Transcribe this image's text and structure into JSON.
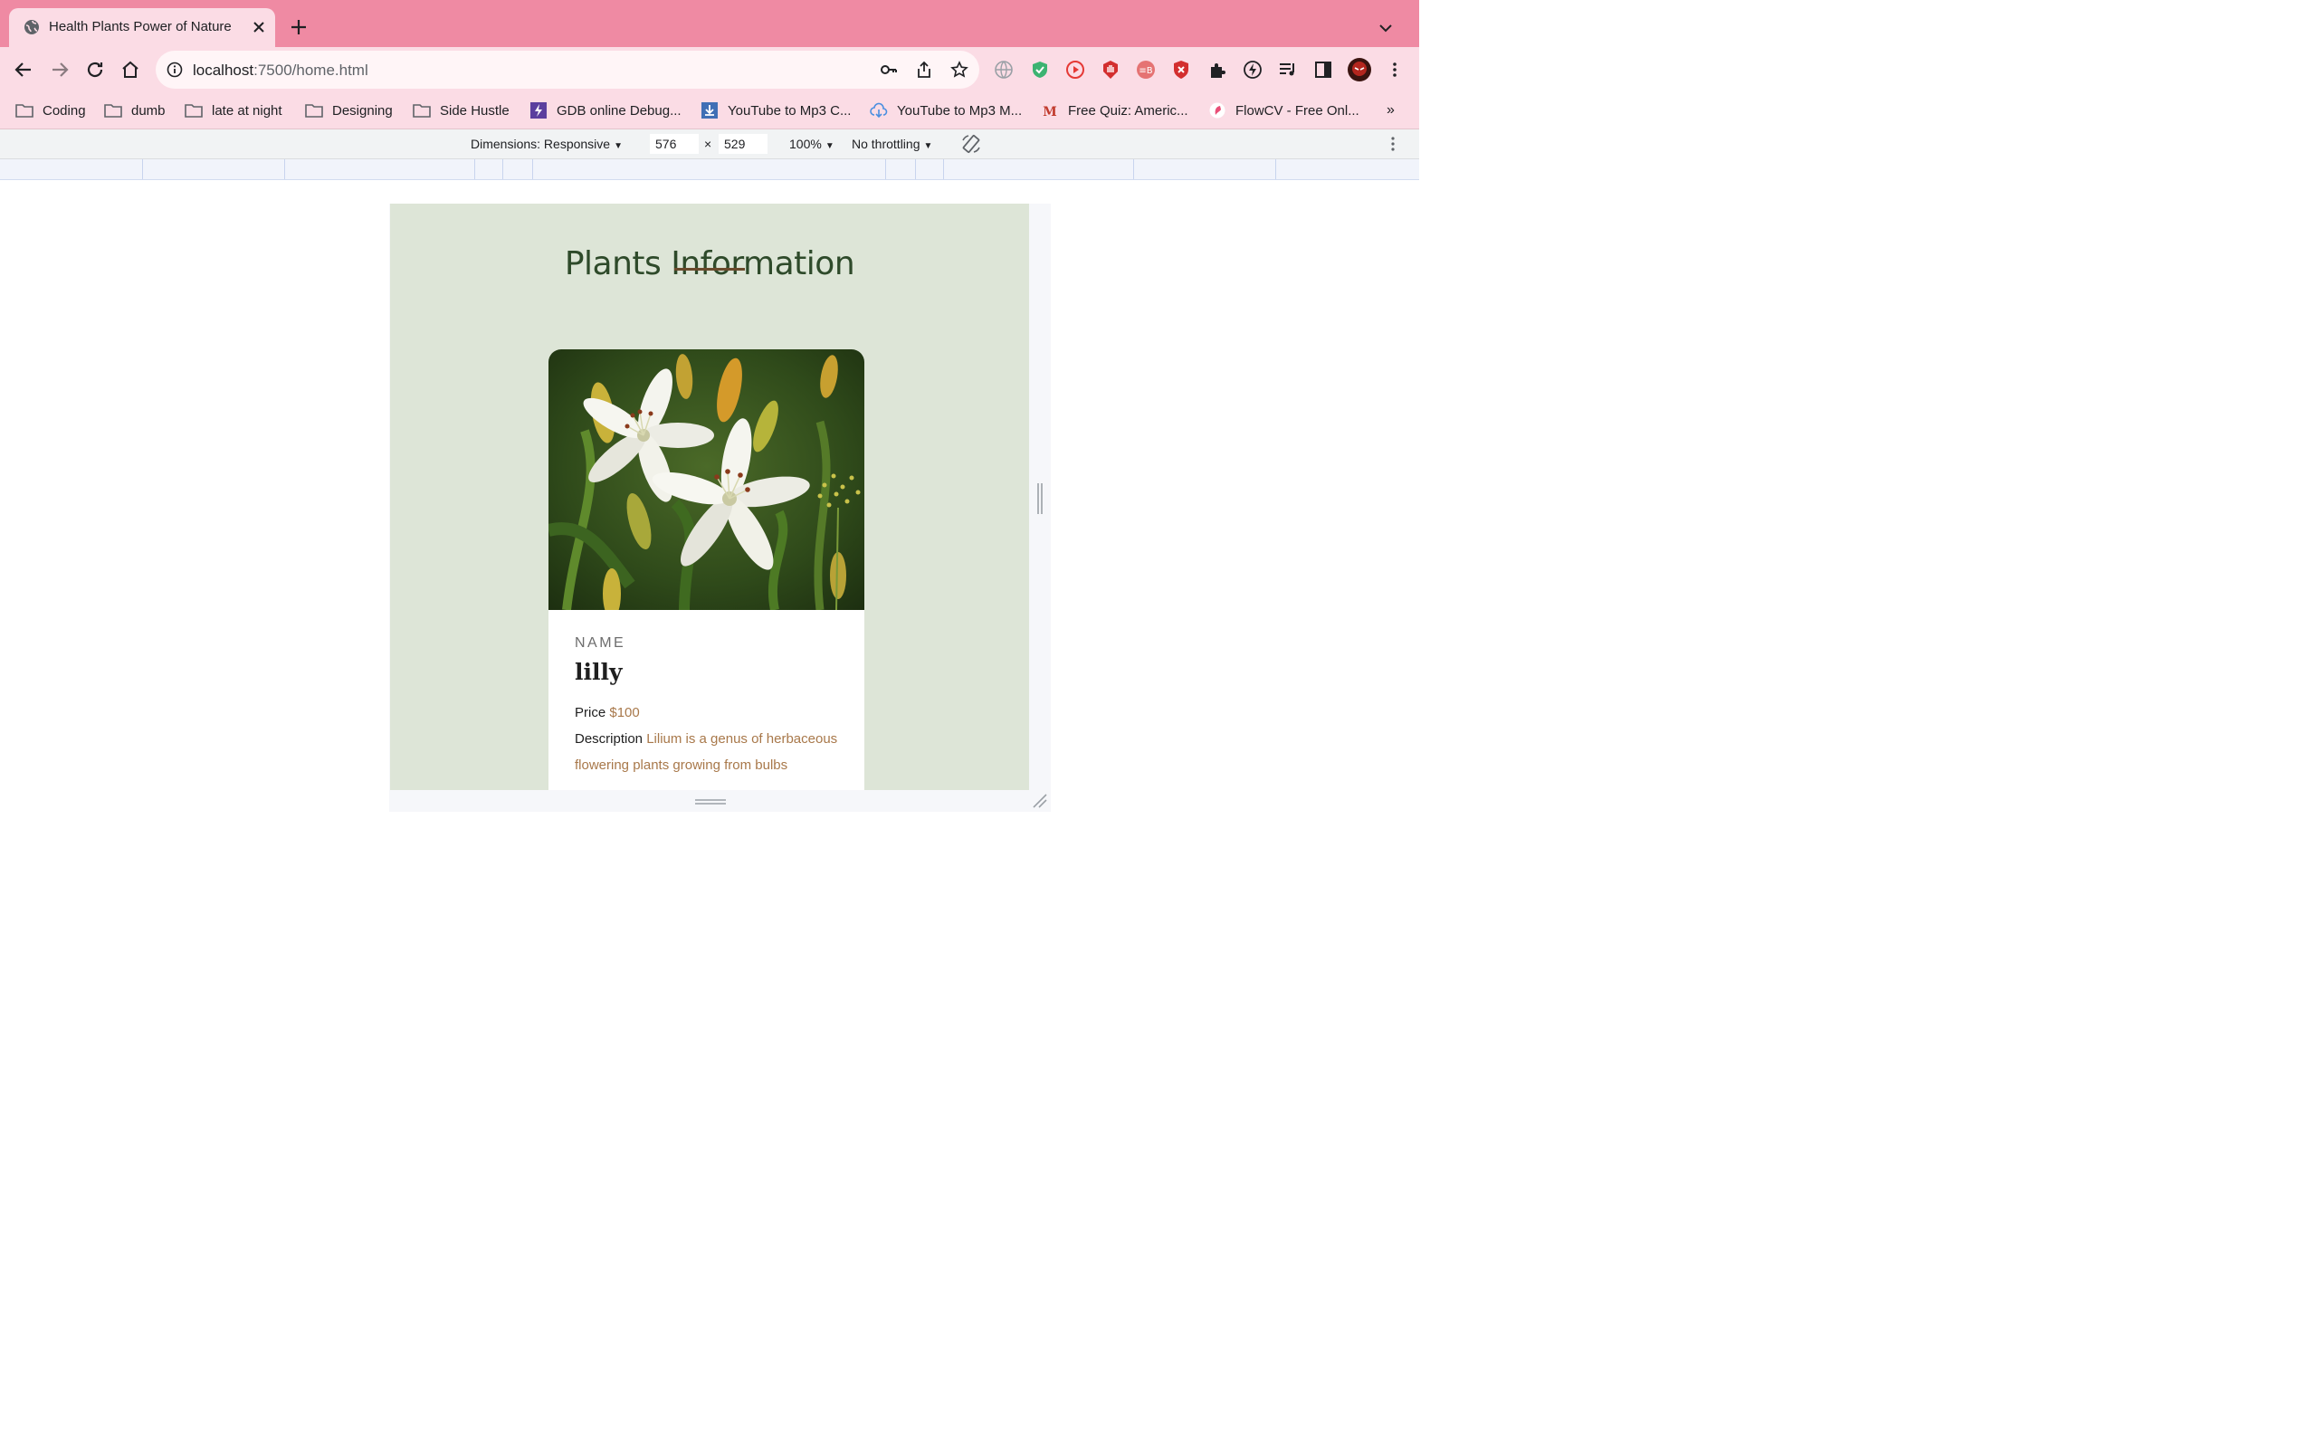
{
  "browser": {
    "tab": {
      "title": "Health Plants Power of Nature"
    },
    "omnibox": {
      "host": "localhost",
      "rest": ":7500/home.html"
    },
    "bookmarks": [
      {
        "label": "Coding",
        "icon": "folder-icon"
      },
      {
        "label": "dumb",
        "icon": "folder-icon"
      },
      {
        "label": "late at night",
        "icon": "folder-icon"
      },
      {
        "label": "Designing",
        "icon": "folder-icon"
      },
      {
        "label": "Side Hustle",
        "icon": "folder-icon"
      },
      {
        "label": "GDB online Debug...",
        "icon": "gdb-icon"
      },
      {
        "label": "YouTube to Mp3 C...",
        "icon": "download-icon"
      },
      {
        "label": "YouTube to Mp3 M...",
        "icon": "cloud-download-icon"
      },
      {
        "label": "Free Quiz: Americ...",
        "icon": "quiz-icon"
      },
      {
        "label": "FlowCV - Free Onl...",
        "icon": "flowcv-icon"
      }
    ],
    "bookmarks_more": "»"
  },
  "devtools": {
    "dimensions_label": "Dimensions: Responsive",
    "width": "576",
    "times": "×",
    "height": "529",
    "zoom": "100%",
    "throttling": "No throttling"
  },
  "page": {
    "title": "Plants Information",
    "card": {
      "name_label": "NAME",
      "name": "lilly",
      "price_label": "Price",
      "price_value": "$100",
      "description_label": "Description",
      "description_value": "Lilium is a genus of herbaceous flowering plants growing from bulbs"
    }
  },
  "colors": {
    "tab_strip": "#ef8aa3",
    "toolbar": "#fbdce5",
    "page_background": "#dde5d7",
    "title_green": "#2e4a2a",
    "accent_brown": "#a8784a"
  }
}
